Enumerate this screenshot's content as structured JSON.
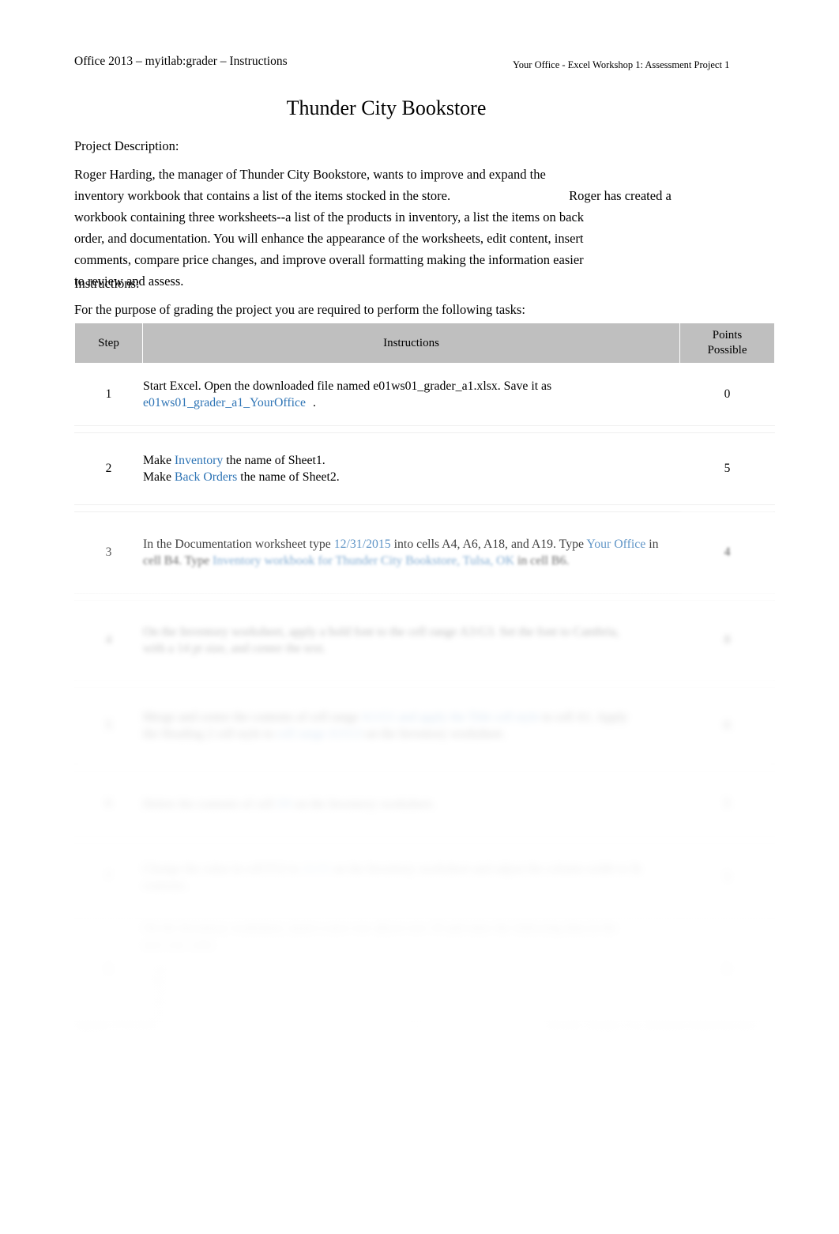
{
  "header": {
    "left": "Office 2013 – myitlab:grader – Instructions",
    "right": "Your Office - Excel Workshop 1: Assessment Project 1"
  },
  "title": "Thunder City Bookstore",
  "labels": {
    "project_description": "Project Description:",
    "instructions": "Instructions:",
    "grading_line": "For the purpose of grading the project you are required to perform the following tasks:"
  },
  "description_lines": [
    "Roger Harding, the manager of Thunder City Bookstore, wants to improve and expand the",
    "inventory workbook that contains a list of the items stocked in the store.",
    "Roger has created a",
    "workbook containing three worksheets--a list of the products in inventory, a list the items on back",
    "order, and documentation. You will enhance the appearance of the worksheets, edit content, insert",
    "comments, compare price changes, and improve overall formatting making the information easier",
    "to review and assess."
  ],
  "table": {
    "columns": {
      "step": "Step",
      "instructions": "Instructions",
      "points_line1": "Points",
      "points_line2": "Possible"
    },
    "rows": [
      {
        "step": "1",
        "points": "0",
        "lines": [
          [
            {
              "t": "Start Excel. Open the downloaded file named e01ws01_grader_a1.xlsx. Save it as",
              "blue": false
            }
          ],
          [
            {
              "t": "e01ws01_grader_a1_YourOffice",
              "blue": true
            },
            {
              "t": ".",
              "blue": false
            }
          ]
        ]
      },
      {
        "step": "2",
        "points": "5",
        "lines": [
          [
            {
              "t": "Make ",
              "blue": false
            },
            {
              "t": "Inventory",
              "blue": true
            },
            {
              "t": " the name of Sheet1.",
              "blue": false
            }
          ],
          [
            {
              "t": "Make ",
              "blue": false
            },
            {
              "t": "Back Orders",
              "blue": true
            },
            {
              "t": " the name of Sheet2.",
              "blue": false
            }
          ]
        ]
      },
      {
        "step": "3",
        "points": "4",
        "lines": [
          [
            {
              "t": "In the Documentation worksheet type ",
              "blue": false
            },
            {
              "t": "12/31/2015",
              "blue": true
            },
            {
              "t": " into cells A4, A6, A18, and A19. Type ",
              "blue": false
            },
            {
              "t": "Your Office",
              "blue": true
            },
            {
              "t": " in",
              "blue": false
            }
          ],
          [
            {
              "t": "cell B4. Type ",
              "blue": false
            },
            {
              "t": "Inventory workbook for Thunder City Bookstore, Tulsa, OK",
              "blue": true
            },
            {
              "t": " in cell B6.",
              "blue": false
            }
          ]
        ]
      },
      {
        "step": "4",
        "points": "8",
        "lines": [
          [
            {
              "t": "On the Inventory worksheet, apply a bold font to the cell range A3:G3. Set the font to Cambria,",
              "blue": false
            }
          ],
          [
            {
              "t": "with a 14 pt size, and center the text.",
              "blue": false
            }
          ]
        ]
      },
      {
        "step": "5",
        "points": "6",
        "lines": [
          [
            {
              "t": "Merge and center the contents of cell range ",
              "blue": false
            },
            {
              "t": "A1:G1 and apply the Title cell style",
              "blue": true
            },
            {
              "t": " to cell A1. Apply",
              "blue": false
            }
          ],
          [
            {
              "t": "the Heading 2 cell style to ",
              "blue": false
            },
            {
              "t": "cell range A3:G3",
              "blue": true
            },
            {
              "t": " on the Inventory worksheet.",
              "blue": false
            }
          ]
        ]
      },
      {
        "step": "6",
        "points": "5",
        "lines": [
          [
            {
              "t": "Delete the contents of cell ",
              "blue": false
            },
            {
              "t": "D9",
              "blue": true
            },
            {
              "t": " on the Inventory worksheet.",
              "blue": false
            }
          ]
        ]
      },
      {
        "step": "7",
        "points": "5",
        "lines": [
          [
            {
              "t": "Change the value in cell F12 to ",
              "blue": false
            },
            {
              "t": "24.95",
              "blue": true
            },
            {
              "t": " on the Inventory worksheet and adjust the column width to fit",
              "blue": false
            }
          ],
          [
            {
              "t": "contents.",
              "blue": false
            }
          ]
        ]
      },
      {
        "step": "8",
        "points": "8",
        "lines": [
          [
            {
              "t": "On the Inventory worksheet, insert a new row above row 10 and enter the following data in the",
              "blue": false
            }
          ],
          [
            {
              "t": "new row cells:",
              "blue": false
            }
          ]
        ],
        "sub_list": [
          "A10",
          "B10",
          "C10",
          "D10",
          "E10"
        ]
      }
    ]
  },
  "footer": {
    "left": "Updated: 07/01/2015",
    "middle": "2",
    "right": "e01ws01_Thunder_City_Bookstore Instructions.docx"
  }
}
